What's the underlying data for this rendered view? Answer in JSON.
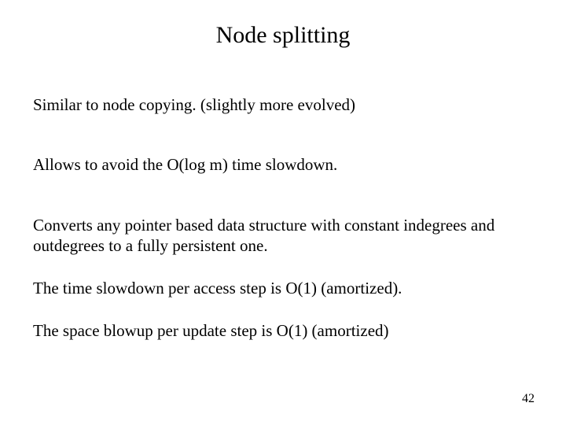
{
  "title": "Node splitting",
  "paragraphs": {
    "p1": "Similar to node copying. (slightly more evolved)",
    "p2": "Allows to avoid the O(log m) time slowdown.",
    "p3": "Converts any pointer based data structure with constant indegrees and outdegrees to a fully persistent one.",
    "p4": "The time slowdown per access step is O(1) (amortized).",
    "p5": "The space blowup per update step is O(1) (amortized)"
  },
  "page_number": "42"
}
